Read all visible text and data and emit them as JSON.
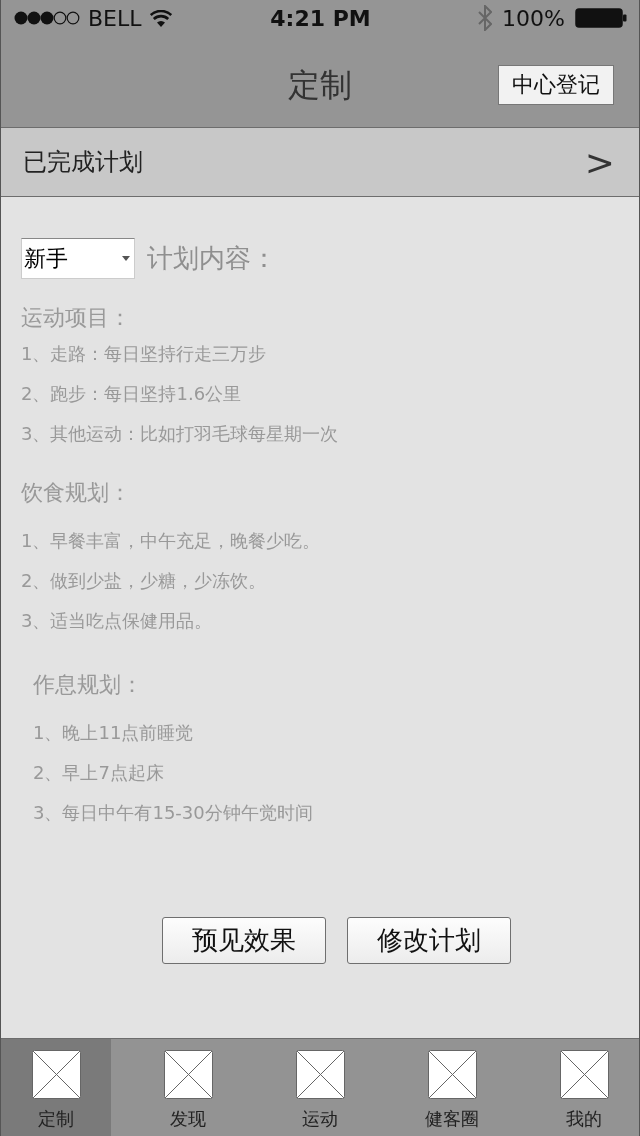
{
  "status_bar": {
    "carrier": "BELL",
    "time": "4:21 PM",
    "battery": "100%"
  },
  "nav_bar": {
    "title": "定制",
    "action": "中心登记"
  },
  "completed_plans_row": {
    "label": "已完成计划",
    "chevron": ">"
  },
  "plan": {
    "level_select": {
      "value": "新手"
    },
    "label": "计划内容："
  },
  "sections": [
    {
      "kind": "flush",
      "heading": "运动项目：",
      "items": [
        "1、走路：每日坚持行走三万步",
        "2、跑步：每日坚持1.6公里",
        "3、其他运动：比如打羽毛球每星期一次"
      ]
    },
    {
      "kind": "flush",
      "heading": "饮食规划：",
      "items": [
        "1、早餐丰富，中午充足，晚餐少吃。",
        "2、做到少盐，少糖，少冻饮。",
        "3、适当吃点保健用品。"
      ]
    },
    {
      "kind": "indented",
      "heading": "作息规划：",
      "items": [
        "1、晚上11点前睡觉",
        "2、早上7点起床",
        "3、每日中午有15-30分钟午觉时间"
      ]
    }
  ],
  "buttons": [
    "预见效果",
    "修改计划"
  ],
  "tab_bar": [
    {
      "label": "定制",
      "selected": true
    },
    {
      "label": "发现",
      "selected": false
    },
    {
      "label": "运动",
      "selected": false
    },
    {
      "label": "健客圈",
      "selected": false
    },
    {
      "label": "我的",
      "selected": false
    }
  ]
}
